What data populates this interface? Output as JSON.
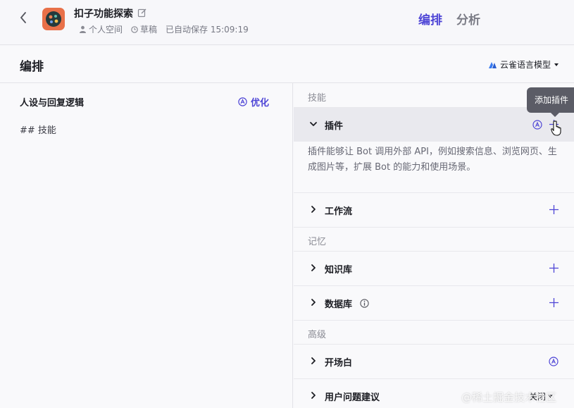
{
  "header": {
    "app_title": "扣子功能探索",
    "meta": {
      "space": "个人空间",
      "status": "草稿",
      "autosave": "已自动保存 15:09:19"
    },
    "tabs": [
      {
        "label": "编排",
        "active": true
      },
      {
        "label": "分析",
        "active": false
      }
    ]
  },
  "section": {
    "title": "编排",
    "model": "云雀语言模型"
  },
  "left_panel": {
    "title": "人设与回复逻辑",
    "optimize_label": "优化",
    "prompt": "## 技能"
  },
  "right_panel": {
    "groups": {
      "skills": "技能",
      "memory": "记忆",
      "advanced": "高级"
    },
    "plugin": {
      "label": "插件",
      "description": "插件能够让 Bot 调用外部 API，例如搜索信息、浏览网页、生成图片等，扩展 Bot 的能力和使用场景。"
    },
    "workflow": {
      "label": "工作流"
    },
    "knowledge": {
      "label": "知识库"
    },
    "database": {
      "label": "数据库"
    },
    "opening": {
      "label": "开场白"
    },
    "suggestions": {
      "label": "用户问题建议",
      "value": "关闭"
    }
  },
  "tooltip": "添加插件",
  "watermark": "@稀土掘金技术社区",
  "colors": {
    "accent": "#4e45d6",
    "avatar_bg": "#e87049"
  }
}
